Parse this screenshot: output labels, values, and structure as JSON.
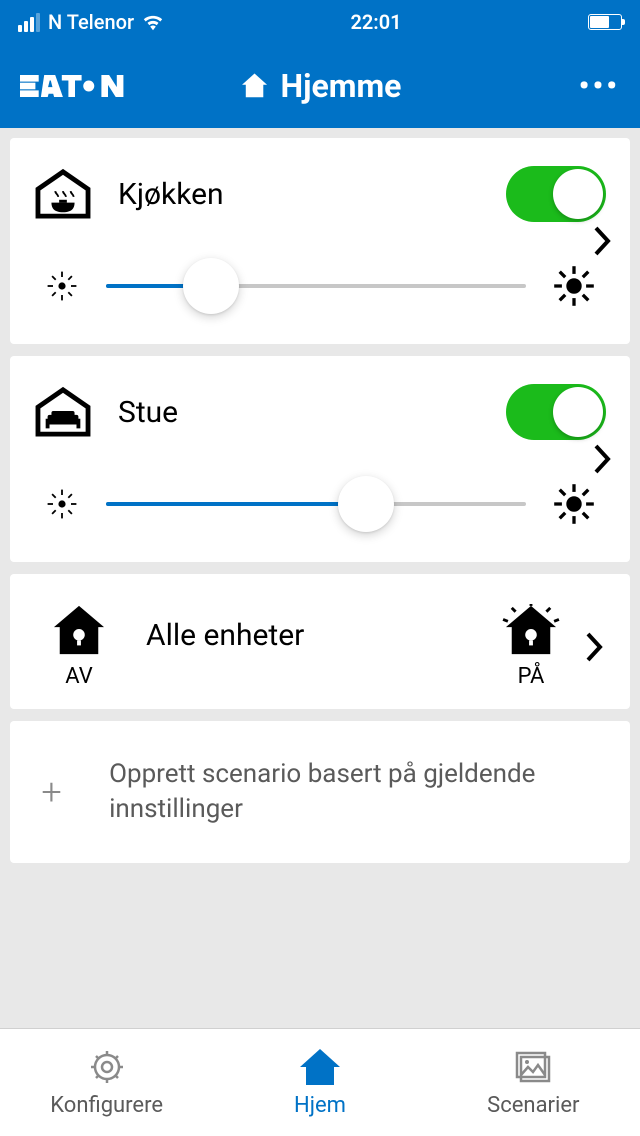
{
  "status": {
    "carrier": "N Telenor",
    "time": "22:01"
  },
  "header": {
    "title": "Hjemme"
  },
  "rooms": [
    {
      "name": "Kjøkken",
      "on": true,
      "brightness_percent": 25
    },
    {
      "name": "Stue",
      "on": true,
      "brightness_percent": 62
    }
  ],
  "allDevices": {
    "title": "Alle enheter",
    "off_label": "AV",
    "on_label": "PÅ"
  },
  "createScenario": {
    "text": "Opprett scenario basert på gjeldende innstillinger"
  },
  "tabs": {
    "configure": "Konfigurere",
    "home": "Hjem",
    "scenarios": "Scenarier"
  }
}
